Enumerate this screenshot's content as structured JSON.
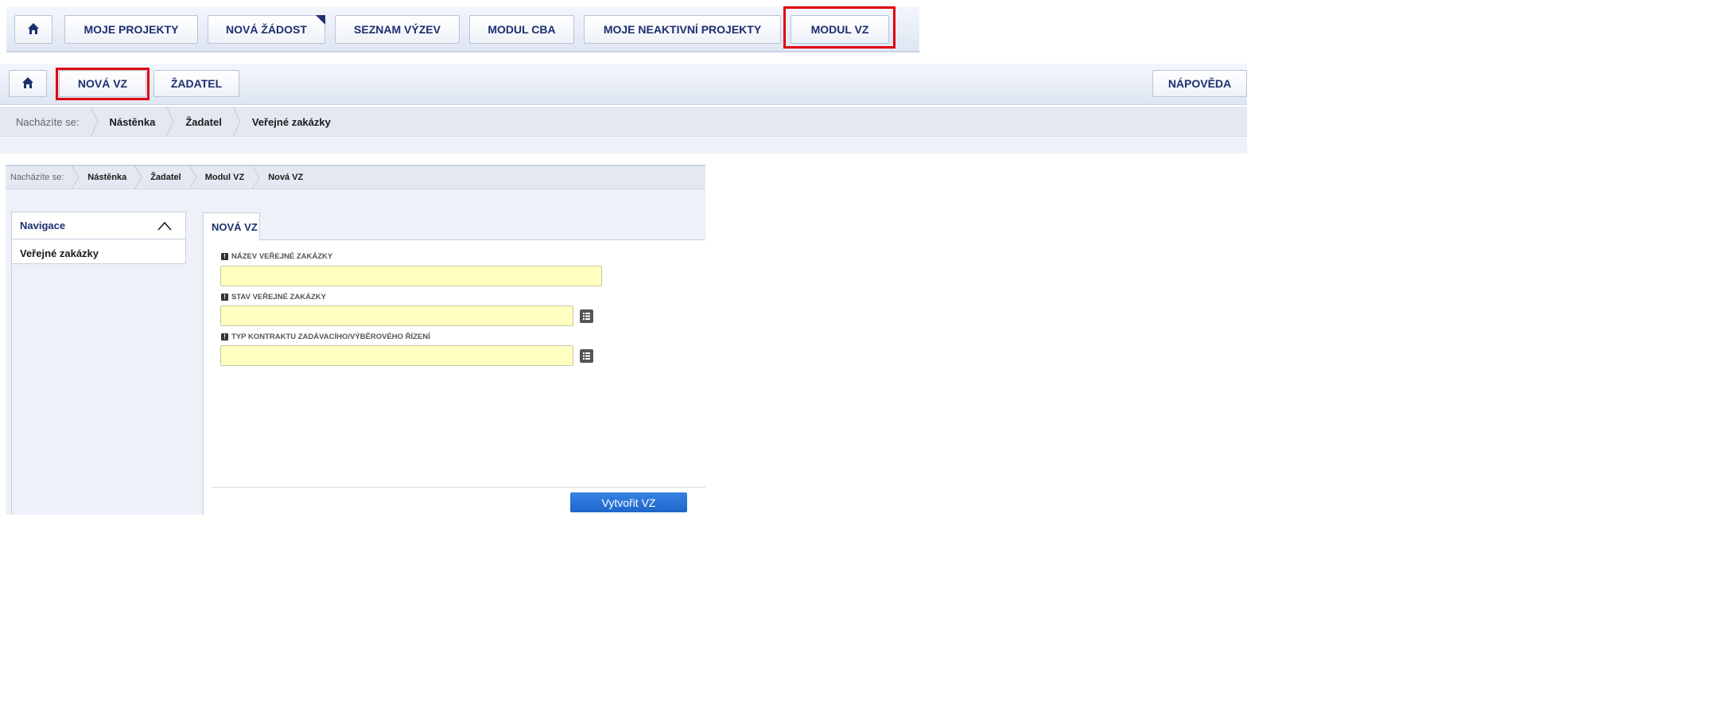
{
  "top_nav": {
    "items": [
      "MOJE PROJEKTY",
      "NOVÁ ŽÁDOST",
      "SEZNAM VÝZEV",
      "MODUL CBA",
      "MOJE NEAKTIVNÍ PROJEKTY",
      "MODUL VZ"
    ]
  },
  "second_nav": {
    "new_vz": "NOVÁ VZ",
    "applicant": "ŽADATEL",
    "help": "NÁPOVĚDA"
  },
  "breadcrumb_1": {
    "prefix": "Nacházíte se:",
    "items": [
      "Nástěnka",
      "Žadatel",
      "Veřejné zakázky"
    ]
  },
  "breadcrumb_2": {
    "prefix": "Nacházíte se:",
    "items": [
      "Nástěnka",
      "Žadatel",
      "Modul VZ",
      "Nová VZ"
    ]
  },
  "sidebar": {
    "title": "Navigace",
    "items": [
      "Veřejné zakázky"
    ]
  },
  "form": {
    "tab": "NOVÁ VZ",
    "fields": [
      {
        "label": "NÁZEV VEŘEJNÉ ZAKÁZKY",
        "value": ""
      },
      {
        "label": "STAV VEŘEJNÉ ZAKÁZKY",
        "value": ""
      },
      {
        "label": "TYP KONTRAKTU ZADÁVACÍHO/VÝBĚROVÉHO ŘÍZENÍ",
        "value": ""
      }
    ],
    "submit": "Vytvořit VZ"
  },
  "icons": {
    "home": "home-icon",
    "collapse": "chevron-up-icon",
    "list": "list-icon",
    "required": "exclamation-icon"
  },
  "colors": {
    "nav_text": "#1d2f6f",
    "highlight": "#e0000f",
    "field_bg": "#ffffc0",
    "submit_bg": "#1f6fd1"
  }
}
